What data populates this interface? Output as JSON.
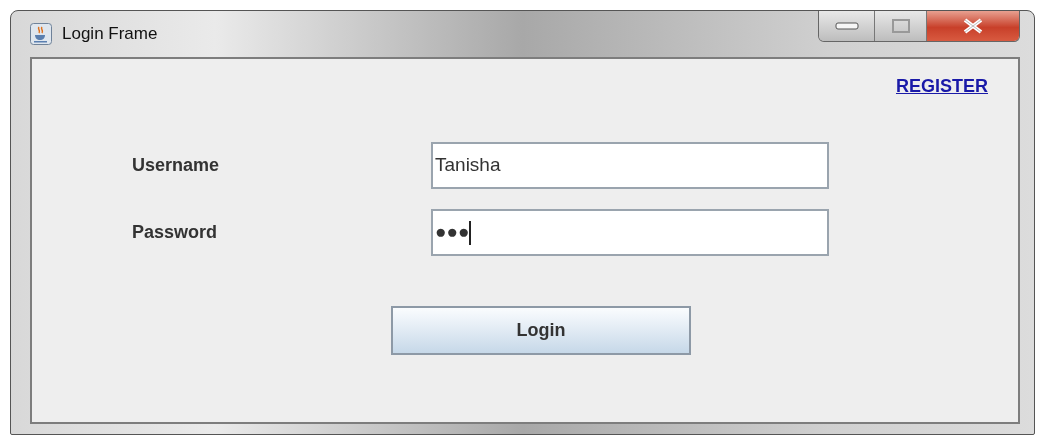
{
  "window": {
    "title": "Login Frame"
  },
  "register_link": {
    "label": "REGISTER"
  },
  "fields": [
    {
      "label": "Username",
      "value": "Tanisha",
      "focused": false
    },
    {
      "label": "Password",
      "value": "●●●",
      "focused": true
    }
  ],
  "buttons": [
    {
      "label": "Login"
    }
  ]
}
